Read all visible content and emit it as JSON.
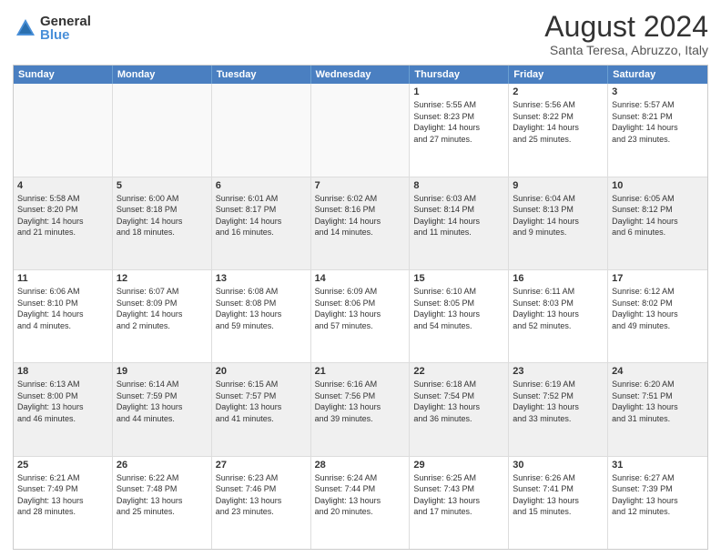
{
  "logo": {
    "general": "General",
    "blue": "Blue"
  },
  "title": "August 2024",
  "location": "Santa Teresa, Abruzzo, Italy",
  "header": {
    "days": [
      "Sunday",
      "Monday",
      "Tuesday",
      "Wednesday",
      "Thursday",
      "Friday",
      "Saturday"
    ]
  },
  "rows": [
    [
      {
        "day": "",
        "info": "",
        "empty": true
      },
      {
        "day": "",
        "info": "",
        "empty": true
      },
      {
        "day": "",
        "info": "",
        "empty": true
      },
      {
        "day": "",
        "info": "",
        "empty": true
      },
      {
        "day": "1",
        "info": "Sunrise: 5:55 AM\nSunset: 8:23 PM\nDaylight: 14 hours\nand 27 minutes.",
        "empty": false
      },
      {
        "day": "2",
        "info": "Sunrise: 5:56 AM\nSunset: 8:22 PM\nDaylight: 14 hours\nand 25 minutes.",
        "empty": false
      },
      {
        "day": "3",
        "info": "Sunrise: 5:57 AM\nSunset: 8:21 PM\nDaylight: 14 hours\nand 23 minutes.",
        "empty": false
      }
    ],
    [
      {
        "day": "4",
        "info": "Sunrise: 5:58 AM\nSunset: 8:20 PM\nDaylight: 14 hours\nand 21 minutes.",
        "empty": false
      },
      {
        "day": "5",
        "info": "Sunrise: 6:00 AM\nSunset: 8:18 PM\nDaylight: 14 hours\nand 18 minutes.",
        "empty": false
      },
      {
        "day": "6",
        "info": "Sunrise: 6:01 AM\nSunset: 8:17 PM\nDaylight: 14 hours\nand 16 minutes.",
        "empty": false
      },
      {
        "day": "7",
        "info": "Sunrise: 6:02 AM\nSunset: 8:16 PM\nDaylight: 14 hours\nand 14 minutes.",
        "empty": false
      },
      {
        "day": "8",
        "info": "Sunrise: 6:03 AM\nSunset: 8:14 PM\nDaylight: 14 hours\nand 11 minutes.",
        "empty": false
      },
      {
        "day": "9",
        "info": "Sunrise: 6:04 AM\nSunset: 8:13 PM\nDaylight: 14 hours\nand 9 minutes.",
        "empty": false
      },
      {
        "day": "10",
        "info": "Sunrise: 6:05 AM\nSunset: 8:12 PM\nDaylight: 14 hours\nand 6 minutes.",
        "empty": false
      }
    ],
    [
      {
        "day": "11",
        "info": "Sunrise: 6:06 AM\nSunset: 8:10 PM\nDaylight: 14 hours\nand 4 minutes.",
        "empty": false
      },
      {
        "day": "12",
        "info": "Sunrise: 6:07 AM\nSunset: 8:09 PM\nDaylight: 14 hours\nand 2 minutes.",
        "empty": false
      },
      {
        "day": "13",
        "info": "Sunrise: 6:08 AM\nSunset: 8:08 PM\nDaylight: 13 hours\nand 59 minutes.",
        "empty": false
      },
      {
        "day": "14",
        "info": "Sunrise: 6:09 AM\nSunset: 8:06 PM\nDaylight: 13 hours\nand 57 minutes.",
        "empty": false
      },
      {
        "day": "15",
        "info": "Sunrise: 6:10 AM\nSunset: 8:05 PM\nDaylight: 13 hours\nand 54 minutes.",
        "empty": false
      },
      {
        "day": "16",
        "info": "Sunrise: 6:11 AM\nSunset: 8:03 PM\nDaylight: 13 hours\nand 52 minutes.",
        "empty": false
      },
      {
        "day": "17",
        "info": "Sunrise: 6:12 AM\nSunset: 8:02 PM\nDaylight: 13 hours\nand 49 minutes.",
        "empty": false
      }
    ],
    [
      {
        "day": "18",
        "info": "Sunrise: 6:13 AM\nSunset: 8:00 PM\nDaylight: 13 hours\nand 46 minutes.",
        "empty": false
      },
      {
        "day": "19",
        "info": "Sunrise: 6:14 AM\nSunset: 7:59 PM\nDaylight: 13 hours\nand 44 minutes.",
        "empty": false
      },
      {
        "day": "20",
        "info": "Sunrise: 6:15 AM\nSunset: 7:57 PM\nDaylight: 13 hours\nand 41 minutes.",
        "empty": false
      },
      {
        "day": "21",
        "info": "Sunrise: 6:16 AM\nSunset: 7:56 PM\nDaylight: 13 hours\nand 39 minutes.",
        "empty": false
      },
      {
        "day": "22",
        "info": "Sunrise: 6:18 AM\nSunset: 7:54 PM\nDaylight: 13 hours\nand 36 minutes.",
        "empty": false
      },
      {
        "day": "23",
        "info": "Sunrise: 6:19 AM\nSunset: 7:52 PM\nDaylight: 13 hours\nand 33 minutes.",
        "empty": false
      },
      {
        "day": "24",
        "info": "Sunrise: 6:20 AM\nSunset: 7:51 PM\nDaylight: 13 hours\nand 31 minutes.",
        "empty": false
      }
    ],
    [
      {
        "day": "25",
        "info": "Sunrise: 6:21 AM\nSunset: 7:49 PM\nDaylight: 13 hours\nand 28 minutes.",
        "empty": false
      },
      {
        "day": "26",
        "info": "Sunrise: 6:22 AM\nSunset: 7:48 PM\nDaylight: 13 hours\nand 25 minutes.",
        "empty": false
      },
      {
        "day": "27",
        "info": "Sunrise: 6:23 AM\nSunset: 7:46 PM\nDaylight: 13 hours\nand 23 minutes.",
        "empty": false
      },
      {
        "day": "28",
        "info": "Sunrise: 6:24 AM\nSunset: 7:44 PM\nDaylight: 13 hours\nand 20 minutes.",
        "empty": false
      },
      {
        "day": "29",
        "info": "Sunrise: 6:25 AM\nSunset: 7:43 PM\nDaylight: 13 hours\nand 17 minutes.",
        "empty": false
      },
      {
        "day": "30",
        "info": "Sunrise: 6:26 AM\nSunset: 7:41 PM\nDaylight: 13 hours\nand 15 minutes.",
        "empty": false
      },
      {
        "day": "31",
        "info": "Sunrise: 6:27 AM\nSunset: 7:39 PM\nDaylight: 13 hours\nand 12 minutes.",
        "empty": false
      }
    ]
  ]
}
